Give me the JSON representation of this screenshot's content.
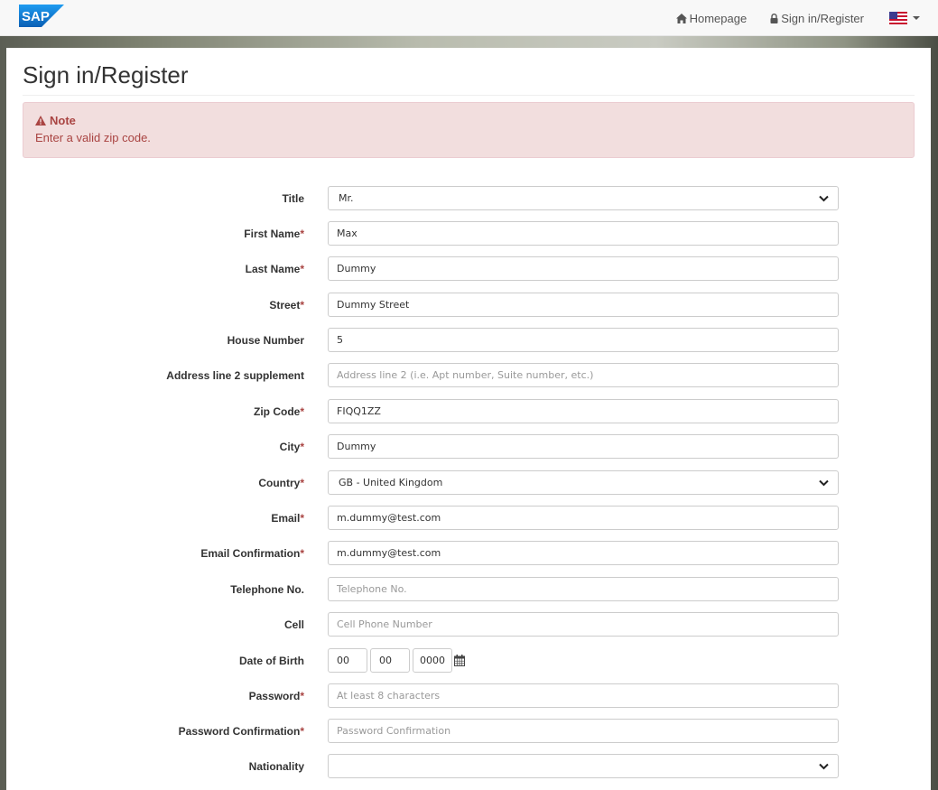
{
  "nav": {
    "logo_text": "SAP",
    "homepage_label": "Homepage",
    "signin_label": "Sign in/Register",
    "language_flag": "us-flag-icon"
  },
  "page": {
    "title": "Sign in/Register"
  },
  "alert": {
    "heading": "Note",
    "message": "Enter a valid zip code."
  },
  "form": {
    "title": {
      "label": "Title",
      "value": "Mr."
    },
    "first_name": {
      "label": "First Name",
      "value": "Max"
    },
    "last_name": {
      "label": "Last Name",
      "value": "Dummy"
    },
    "street": {
      "label": "Street",
      "value": "Dummy Street"
    },
    "house_number": {
      "label": "House Number",
      "value": "5"
    },
    "address2": {
      "label": "Address line 2 supplement",
      "placeholder": "Address line 2 (i.e. Apt number, Suite number, etc.)"
    },
    "zip": {
      "label": "Zip Code",
      "value": "FIQQ1ZZ"
    },
    "city": {
      "label": "City",
      "value": "Dummy"
    },
    "country": {
      "label": "Country",
      "value": "GB - United Kingdom"
    },
    "email": {
      "label": "Email",
      "value": "m.dummy@test.com"
    },
    "email_confirm": {
      "label": "Email Confirmation",
      "value": "m.dummy@test.com"
    },
    "telephone": {
      "label": "Telephone No.",
      "placeholder": "Telephone No."
    },
    "cell": {
      "label": "Cell",
      "placeholder": "Cell Phone Number"
    },
    "dob": {
      "label": "Date of Birth",
      "day": "00",
      "month": "00",
      "year": "0000"
    },
    "password": {
      "label": "Password",
      "placeholder": "At least 8 characters"
    },
    "password_confirm": {
      "label": "Password Confirmation",
      "placeholder": "Password Confirmation"
    },
    "nationality": {
      "label": "Nationality",
      "value": ""
    },
    "required_marker": "*"
  },
  "colors": {
    "alert_bg": "#f2dede",
    "alert_text": "#a94442",
    "sap_blue": "#0a6ed1"
  }
}
